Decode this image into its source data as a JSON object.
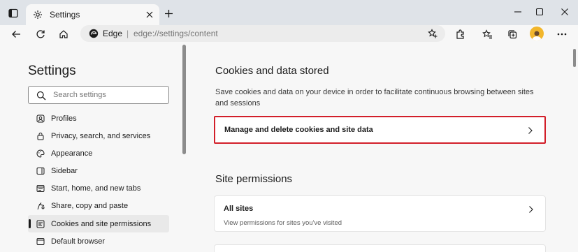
{
  "browser": {
    "tab": {
      "title": "Settings"
    },
    "address": {
      "brand": "Edge",
      "separator": "|",
      "url": "edge://settings/content"
    }
  },
  "sidebar": {
    "title": "Settings",
    "search_placeholder": "Search settings",
    "items": [
      {
        "label": "Profiles",
        "icon": "profile-icon"
      },
      {
        "label": "Privacy, search, and services",
        "icon": "lock-icon"
      },
      {
        "label": "Appearance",
        "icon": "palette-icon"
      },
      {
        "label": "Sidebar",
        "icon": "sidebar-icon"
      },
      {
        "label": "Start, home, and new tabs",
        "icon": "home-tabs-icon"
      },
      {
        "label": "Share, copy and paste",
        "icon": "share-icon"
      },
      {
        "label": "Cookies and site permissions",
        "icon": "cookie-permissions-icon",
        "selected": true
      },
      {
        "label": "Default browser",
        "icon": "browser-icon"
      }
    ]
  },
  "main": {
    "cookies_section": {
      "title": "Cookies and data stored",
      "description": "Save cookies and data on your device in order to facilitate continuous browsing between sites and sessions",
      "manage_label": "Manage and delete cookies and site data"
    },
    "permissions_section": {
      "title": "Site permissions",
      "all_sites_label": "All sites",
      "all_sites_sub": "View permissions for sites you've visited"
    }
  },
  "colors": {
    "highlight_border": "#d21f2a",
    "avatar": "#f2b62b"
  }
}
